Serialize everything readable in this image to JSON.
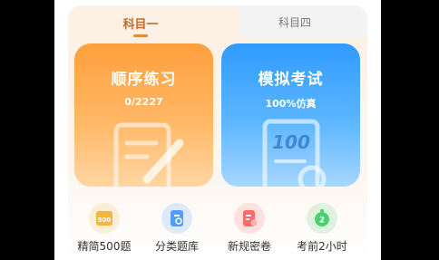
{
  "tabs": [
    {
      "label": "科目一",
      "active": true
    },
    {
      "label": "科目四",
      "active": false
    }
  ],
  "cards": {
    "sequence": {
      "title": "顺序练习",
      "subtitle": "0/2227"
    },
    "mock": {
      "title": "模拟考试",
      "subtitle": "100%仿真",
      "icon_text": "100"
    }
  },
  "shortcuts": [
    {
      "label": "精简500题",
      "icon": "500-book-icon",
      "icon_text": "500",
      "color": "#f5b73b"
    },
    {
      "label": "分类题库",
      "icon": "category-bank-icon",
      "color": "#4f9dff"
    },
    {
      "label": "新规密卷",
      "icon": "new-rules-paper-icon",
      "color": "#ff6b6b"
    },
    {
      "label": "考前2小时",
      "icon": "two-hour-timer-icon",
      "icon_text": "2",
      "color": "#4ccf6e"
    }
  ]
}
